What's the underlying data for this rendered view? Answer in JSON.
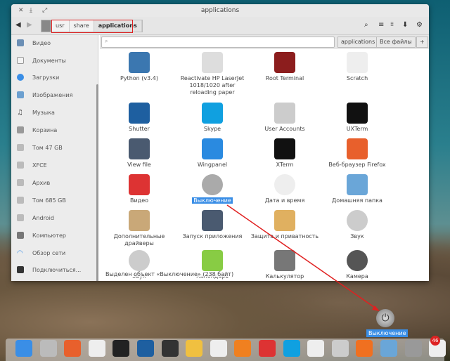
{
  "window": {
    "title": "applications"
  },
  "breadcrumb": [
    "usr",
    "share",
    "applications"
  ],
  "sidebar": {
    "items": [
      "Видео",
      "Документы",
      "Загрузки",
      "Изображения",
      "Музыка",
      "Корзина",
      "Том 47 GB",
      "XFCE",
      "Архив",
      "Том 685 GB",
      "Android",
      "Компьютер",
      "Обзор сети",
      "Подключиться..."
    ]
  },
  "search": {
    "placeholder": "",
    "scope_current": "applications",
    "scope_all": "Все файлы",
    "add": "+"
  },
  "apps": [
    "Python (v3.4)",
    "Reactivate HP LaserJet 1018/1020 after reloading paper",
    "Root Terminal",
    "Scratch",
    "Shutter",
    "Skype",
    "User Accounts",
    "UXTerm",
    "View file",
    "Wingpanel",
    "XTerm",
    "Веб-браузер Firefox",
    "Видео",
    "Выключение",
    "Дата и время",
    "Домашняя папка",
    "Дополнительные драйверы",
    "Запуск приложения",
    "Защита и приватность",
    "Звук",
    "Звук",
    "Календарь",
    "Калькулятор",
    "Камера"
  ],
  "status": "Выделен объект «Выключение» (238 байт)",
  "selected_app": "Выключение",
  "tooltip": "Выключение",
  "dock": {
    "badge": "46"
  },
  "colors": {
    "accent": "#3a8ee6",
    "annotation": "#e02020"
  }
}
